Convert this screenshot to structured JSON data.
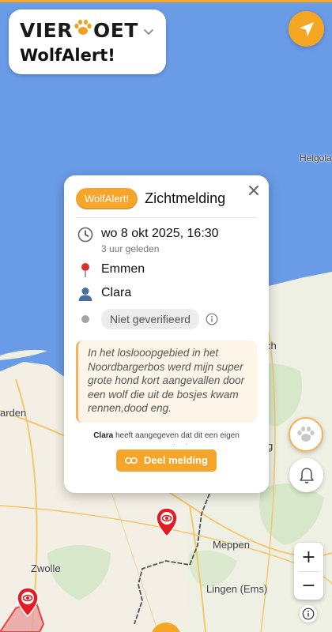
{
  "brand": {
    "logo_left": "VIER",
    "logo_right": "OET",
    "subtitle": "WolfAlert!"
  },
  "map": {
    "labels": {
      "helgoland": "Helgola",
      "leeuwarden": "arden",
      "meppen": "Meppen",
      "zwolle": "Zwolle",
      "lingen": "Lingen (Ems)",
      "ch": "ch",
      "g": "g"
    }
  },
  "popup": {
    "badge": "WolfAlert!",
    "title": "Zichtmelding",
    "datetime": "wo 8 okt 2025, 16:30",
    "relative": "3 uur geleden",
    "location": "Emmen",
    "user": "Clara",
    "status": "Niet geverifieerd",
    "description": "In het loslooopgebied in het Noordbargerbos werd mijn super grote hond kort aangevallen door een wolf die uit de bosjes kwam rennen,dood eng.",
    "note_user": "Clara",
    "note_text": " heeft aangegeven dat dit een eigen waarneming is",
    "share_label": "Deel melding"
  },
  "controls": {
    "zoom_in": "+",
    "zoom_out": "−"
  },
  "colors": {
    "accent": "#f5a623",
    "sea": "#6a9be6",
    "land": "#f2efe6",
    "marker": "#e31b23"
  },
  "icons": {
    "locate": "navigation-arrow-icon",
    "close": "close-icon",
    "clock": "clock-icon",
    "pin": "pushpin-icon",
    "user": "user-icon",
    "status": "status-dot-icon",
    "info": "info-icon",
    "link": "link-icon",
    "paw": "paw-icon",
    "bell": "bell-icon"
  }
}
